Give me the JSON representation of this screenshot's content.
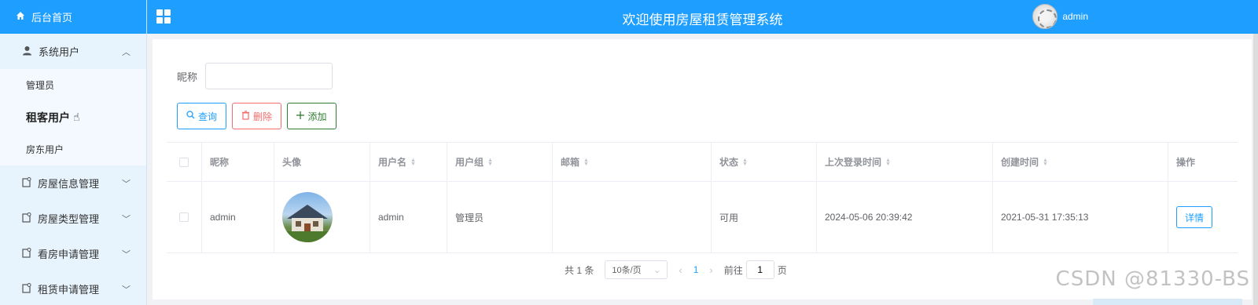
{
  "sidebar": {
    "home": "后台首页",
    "group_users": "系统用户",
    "sub_items": [
      "管理员",
      "租客用户",
      "房东用户"
    ],
    "groups": [
      "房屋信息管理",
      "房屋类型管理",
      "看房申请管理",
      "租赁申请管理"
    ]
  },
  "header": {
    "title": "欢迎使用房屋租赁管理系统",
    "username": "admin"
  },
  "search": {
    "label": "昵称",
    "value": "",
    "placeholder": ""
  },
  "toolbar": {
    "query": "查询",
    "delete": "删除",
    "add": "添加"
  },
  "table": {
    "headers": [
      "昵称",
      "头像",
      "用户名",
      "用户组",
      "邮箱",
      "状态",
      "上次登录时间",
      "创建时间",
      "操作"
    ],
    "rows": [
      {
        "nickname": "admin",
        "username": "admin",
        "group": "管理员",
        "email": "",
        "status": "可用",
        "last_login": "2024-05-06 20:39:42",
        "created": "2021-05-31 17:35:13",
        "action": "详情"
      }
    ]
  },
  "pagination": {
    "total": "共 1 条",
    "page_size": "10条/页",
    "current_page": "1",
    "goto_label": "前往",
    "goto_value": "1",
    "page_unit": "页"
  },
  "watermark": "CSDN @81330-BS",
  "colors": {
    "primary": "#1e9fff",
    "danger": "#f56c6c",
    "success": "#2f7d32"
  }
}
